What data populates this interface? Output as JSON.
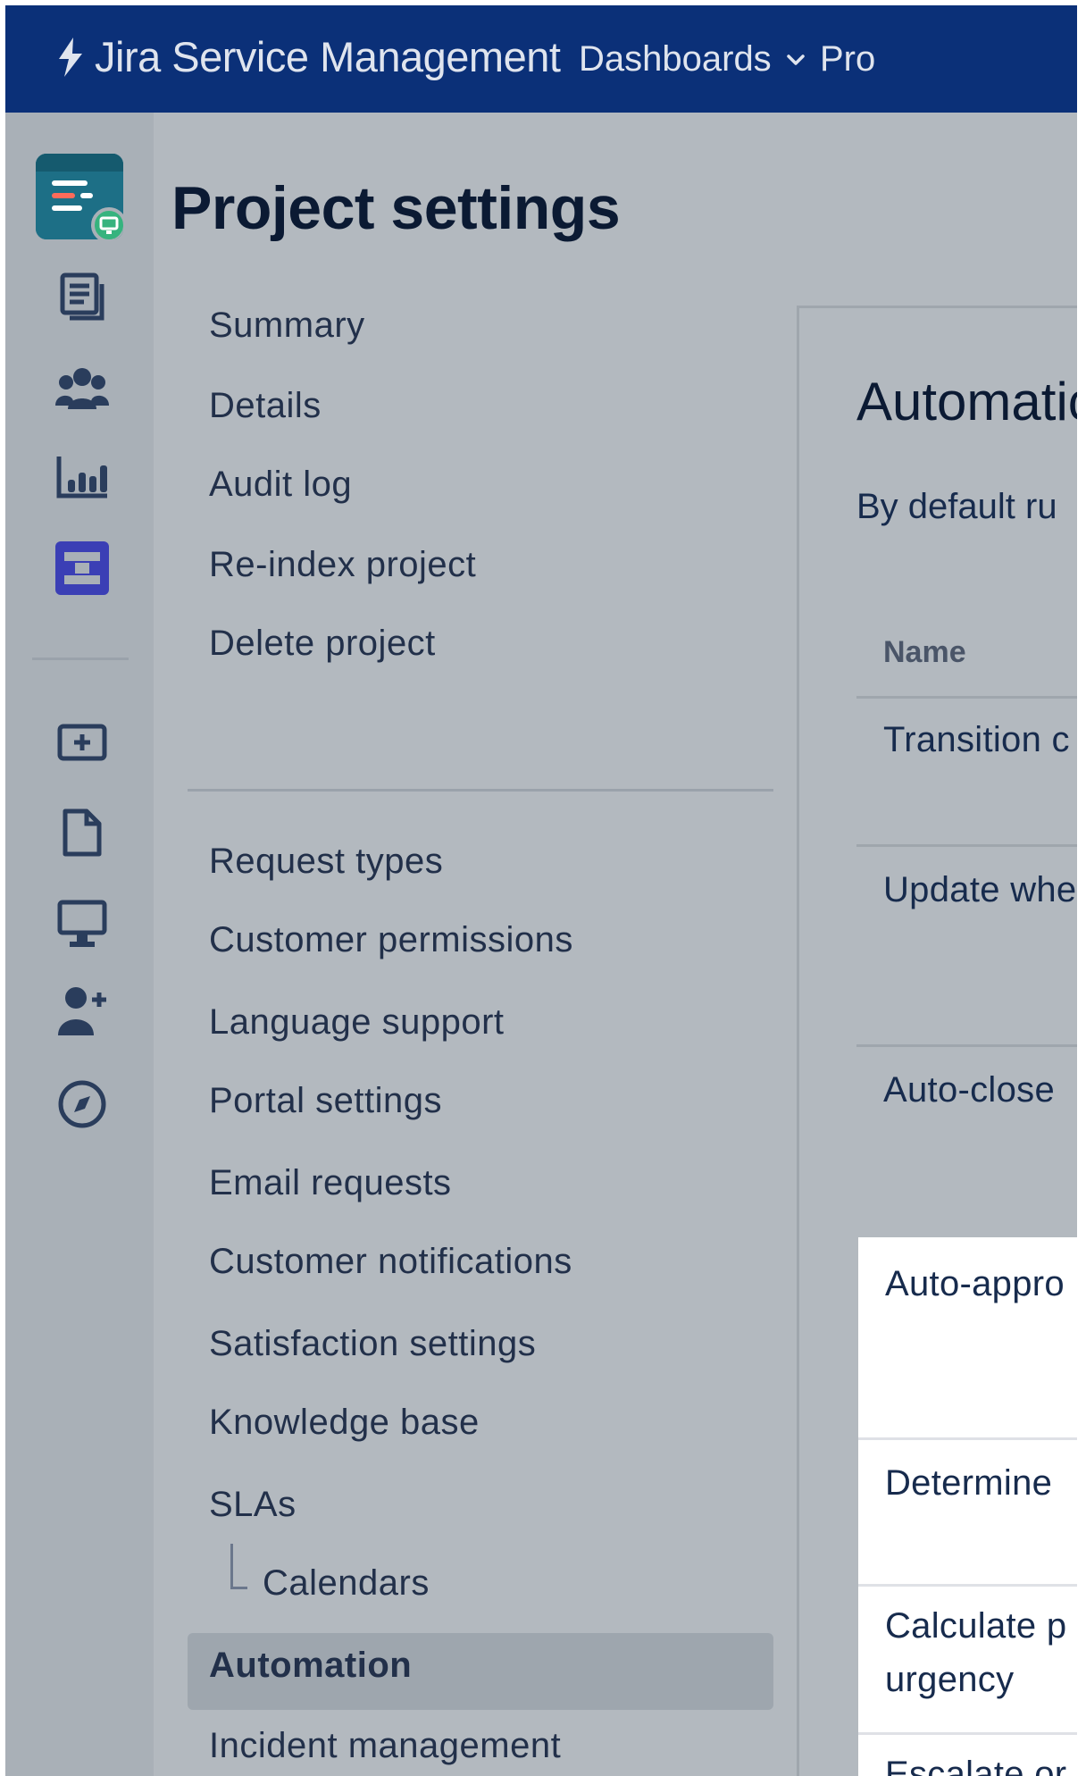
{
  "topnav": {
    "brand": "Jira Service Management",
    "links": [
      {
        "label": "Dashboards"
      },
      {
        "label": "Pro"
      }
    ],
    "colors": {
      "bar": "#0b3078",
      "text": "#dfe4ee"
    }
  },
  "sidebar_icons": [
    "project-avatar-icon",
    "queues-icon",
    "customers-icon",
    "reports-icon",
    "service-desk-icon",
    "add-item-icon",
    "page-icon",
    "monitor-icon",
    "add-user-icon",
    "compass-icon"
  ],
  "page": {
    "title": "Project settings"
  },
  "settings_nav": {
    "group1": [
      "Summary",
      "Details",
      "Audit log",
      "Re-index project",
      "Delete project"
    ],
    "group2": [
      "Request types",
      "Customer permissions",
      "Language support",
      "Portal settings",
      "Email requests",
      "Customer notifications",
      "Satisfaction settings",
      "Knowledge base",
      "SLAs"
    ],
    "sub_item": "Calendars",
    "active": "Automation",
    "after": "Incident management"
  },
  "main": {
    "title": "Automatic",
    "description": "By default ru",
    "column_name": "Name",
    "rows": [
      "Transition c",
      "Update whe",
      "Auto-close"
    ],
    "panel_rows": [
      "Auto-appro",
      "Determine",
      "Calculate p",
      "urgency",
      "Escalate or"
    ]
  }
}
